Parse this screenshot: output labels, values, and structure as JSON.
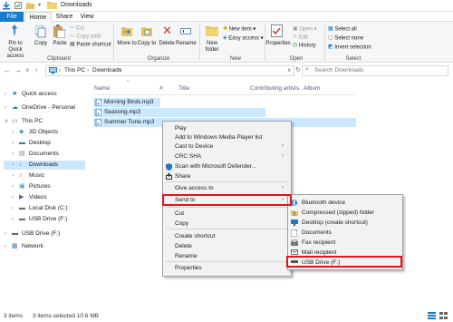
{
  "window": {
    "title": "Downloads"
  },
  "tabs": [
    "File",
    "Home",
    "Share",
    "View"
  ],
  "ribbon": {
    "clipboard": {
      "pin_label": "Pin to Quick access",
      "copy_label": "Copy",
      "paste_label": "Paste",
      "cut_label": "Cut",
      "copy_path_label": "Copy path",
      "paste_shortcut_label": "Paste shortcut",
      "group_label": "Clipboard"
    },
    "organize": {
      "move_to_label": "Move to",
      "copy_to_label": "Copy to",
      "delete_label": "Delete",
      "rename_label": "Rename",
      "group_label": "Organize"
    },
    "new": {
      "new_folder_label": "New folder",
      "new_item_label": "New item",
      "easy_access_label": "Easy access",
      "group_label": "New"
    },
    "open": {
      "properties_label": "Properties",
      "open_label": "Open",
      "edit_label": "Edit",
      "history_label": "History",
      "group_label": "Open"
    },
    "select": {
      "select_all_label": "Select all",
      "select_none_label": "Select none",
      "invert_label": "Invert selection",
      "group_label": "Select"
    }
  },
  "address": {
    "crumbs": [
      "This PC",
      "Downloads"
    ],
    "search_placeholder": "Search Downloads"
  },
  "nav_pane": {
    "items": [
      {
        "label": "Quick access",
        "icon": "star-icon"
      },
      {
        "label": "OneDrive - Personal",
        "icon": "cloud-icon"
      },
      {
        "label": "This PC",
        "icon": "pc-icon"
      },
      {
        "label": "3D Objects",
        "icon": "cube-icon"
      },
      {
        "label": "Desktop",
        "icon": "desktop-folder-icon"
      },
      {
        "label": "Documents",
        "icon": "documents-icon"
      },
      {
        "label": "Downloads",
        "icon": "downloads-icon"
      },
      {
        "label": "Music",
        "icon": "music-icon"
      },
      {
        "label": "Pictures",
        "icon": "pictures-icon"
      },
      {
        "label": "Videos",
        "icon": "videos-icon"
      },
      {
        "label": "Local Disk (C:)",
        "icon": "disk-icon"
      },
      {
        "label": "USB Drive (F:)",
        "icon": "usb-icon"
      },
      {
        "label": "USB Drive (F:)",
        "icon": "usb-icon"
      },
      {
        "label": "Network",
        "icon": "network-icon"
      }
    ]
  },
  "file_list": {
    "columns": [
      "Name",
      "#",
      "Title",
      "Contributing artists",
      "Album"
    ],
    "rows": [
      {
        "name": "Morning Birds.mp3"
      },
      {
        "name": "Seasong.mp3"
      },
      {
        "name": "Summer Tune.mp3"
      }
    ]
  },
  "context_menu": {
    "items": [
      "Play",
      "Add to Windows Media Player list",
      "Cast to Device",
      "CRC SHA",
      "Scan with Microsoft Defender...",
      "Share",
      "Give access to",
      "Send to",
      "Cut",
      "Copy",
      "Create shortcut",
      "Delete",
      "Rename",
      "Properties"
    ]
  },
  "send_to": {
    "items": [
      "Bluetooth device",
      "Compressed (zipped) folder",
      "Desktop (create shortcut)",
      "Documents",
      "Fax recipient",
      "Mail recipient",
      "USB Drive (F:)"
    ]
  },
  "status": {
    "count": "3 items",
    "selection": "3 items selected  10.6 MB"
  },
  "colors": {
    "accent": "#1979ca",
    "selection": "#cce8ff",
    "highlight_box": "#e0141c"
  }
}
